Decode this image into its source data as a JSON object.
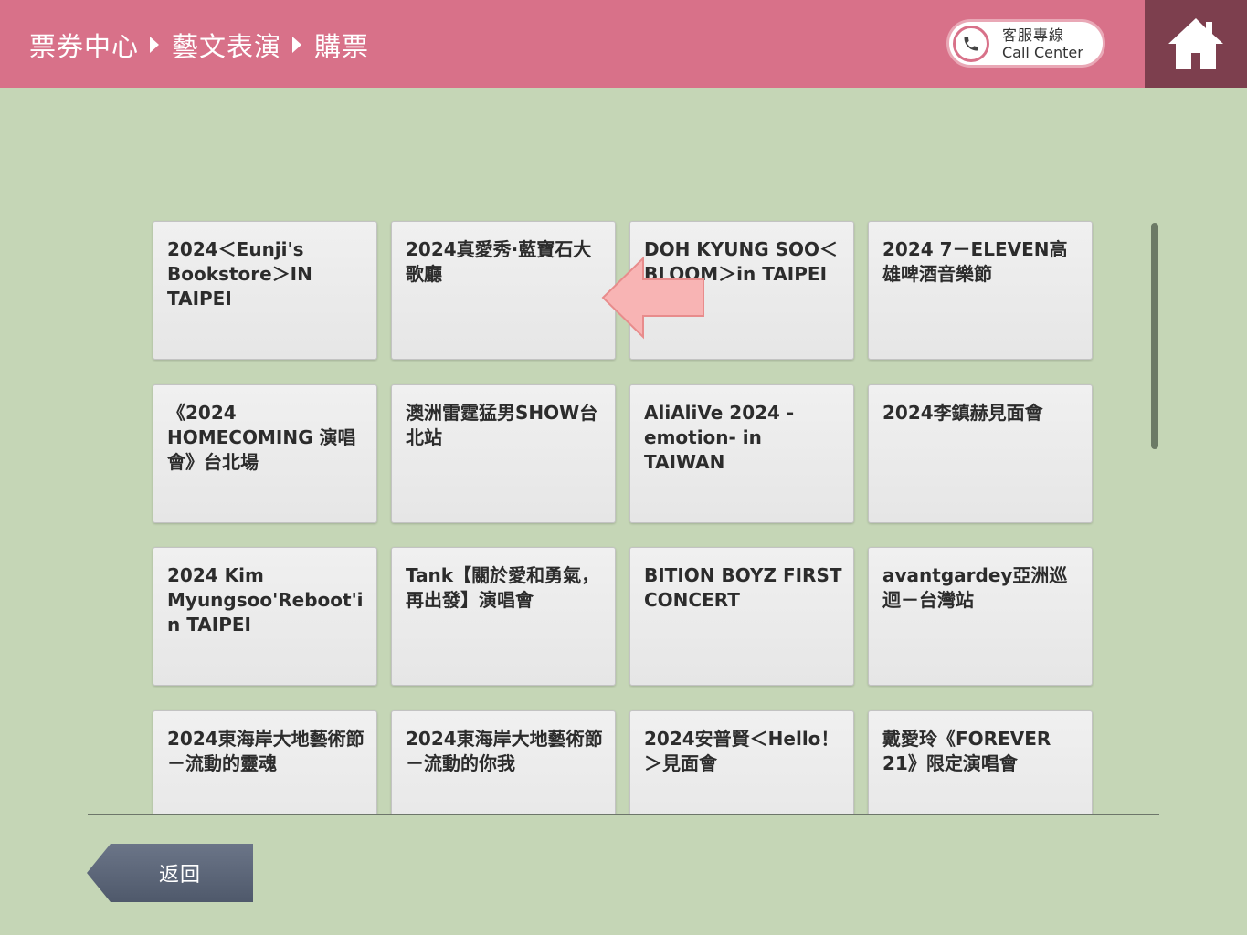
{
  "header": {
    "breadcrumb": [
      "票券中心",
      "藝文表演",
      "購票"
    ],
    "call_center_zh": "客服專線",
    "call_center_en": "Call Center",
    "colors": {
      "bar": "#d87189",
      "home": "#7d3f4e",
      "background": "#c5d6b6"
    }
  },
  "tiles": [
    "2024＜Eunji's Bookstore＞IN TAIPEI",
    "2024真愛秀·藍寶石大歌廳",
    "DOH KYUNG SOO＜BLOOM＞in TAIPEI",
    "2024 7－ELEVEN高雄啤酒音樂節",
    "《2024 HOMECOMING 演唱會》台北場",
    "澳洲雷霆猛男SHOW台北站",
    "AliAliVe 2024 -emotion- in TAIWAN",
    "2024李鎮赫見面會",
    "2024 Kim Myungsoo'Reboot'in TAIPEI",
    "Tank【關於愛和勇氣，再出發】演唱會",
    "BITION BOYZ FIRST CONCERT",
    "avantgardey亞洲巡迴－台灣站",
    "2024東海岸大地藝術節－流動的靈魂",
    "2024東海岸大地藝術節－流動的你我",
    "2024安普賢＜Hello！＞見面會",
    "戴愛玲《FOREVER 21》限定演唱會"
  ],
  "back_label": "返回",
  "icons": {
    "home": "home-icon",
    "phone": "phone-icon",
    "pointer": "arrow-left-icon"
  }
}
